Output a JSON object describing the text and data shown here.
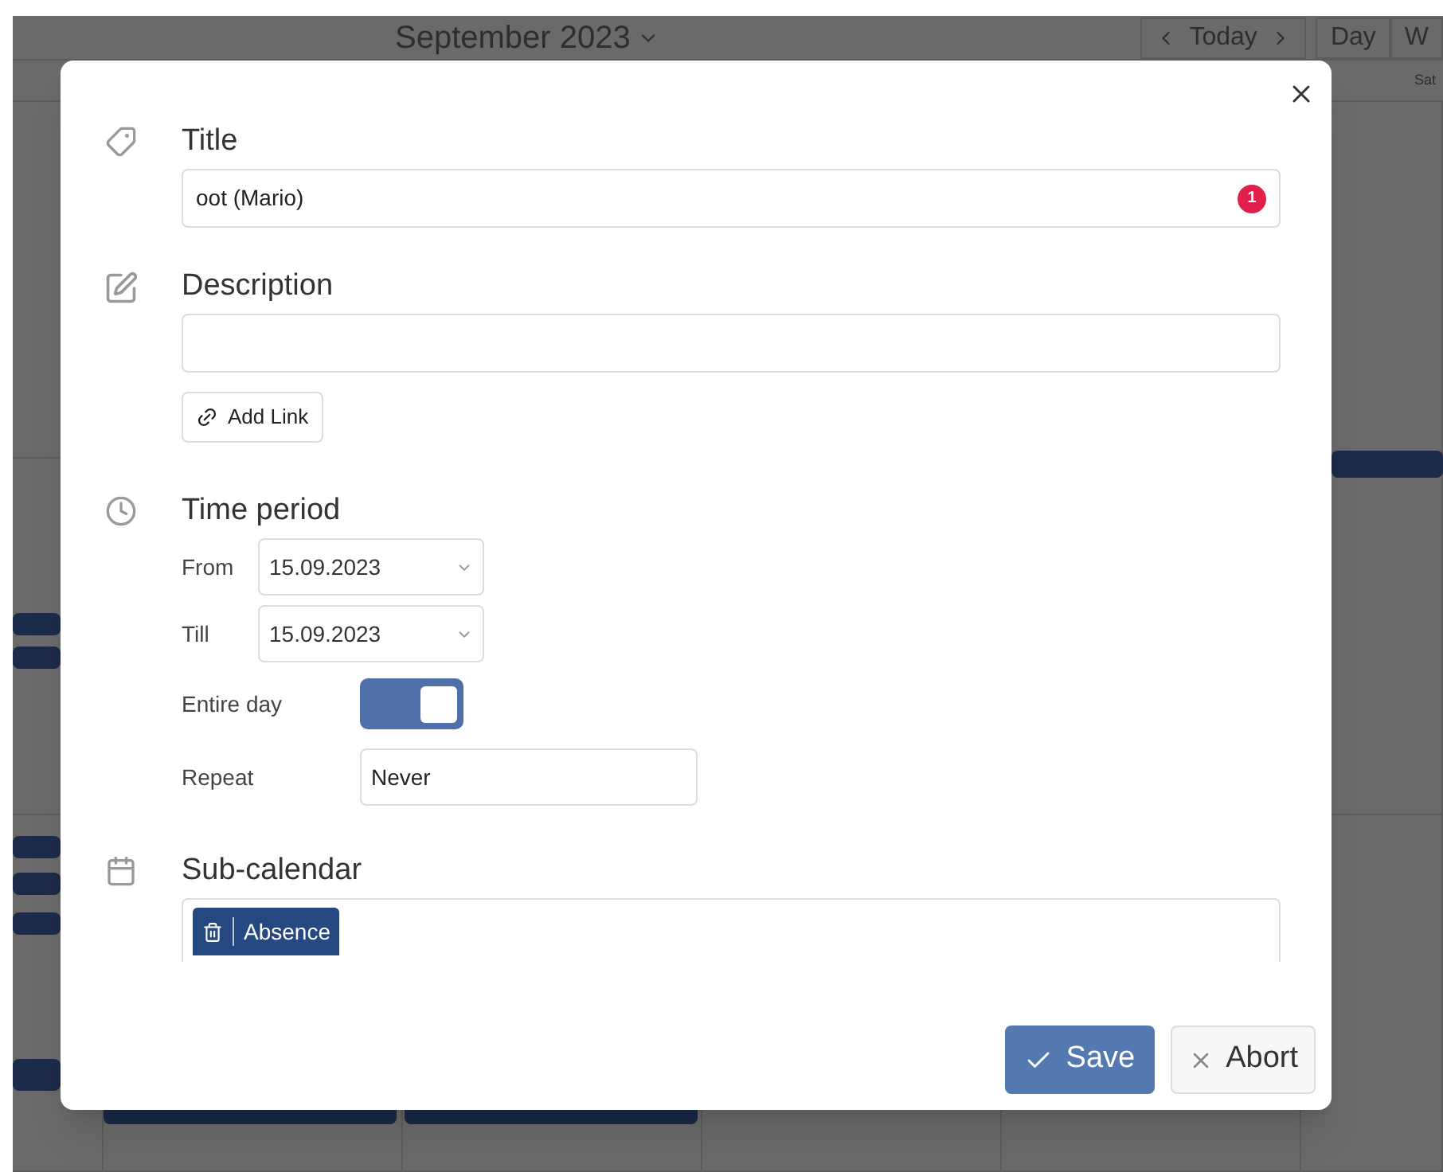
{
  "calendar": {
    "month": "September 2023",
    "today": "Today",
    "views": [
      "Day",
      "W"
    ],
    "weekday": "Sat"
  },
  "dialog": {
    "title_section": {
      "label": "Title",
      "value": "oot (Mario)",
      "badge": "1"
    },
    "description_section": {
      "label": "Description",
      "add_link": "Add Link"
    },
    "time_section": {
      "label": "Time period",
      "rows": [
        {
          "label": "From",
          "value": "15.09.2023"
        },
        {
          "label": "Till",
          "value": "15.09.2023"
        }
      ],
      "entire_day": {
        "label": "Entire day",
        "on": true
      },
      "repeat": {
        "label": "Repeat",
        "value": "Never"
      }
    },
    "subcalendar_section": {
      "label": "Sub-calendar",
      "chips": [
        {
          "label": "Absence"
        }
      ]
    },
    "buttons": [
      {
        "kind": "primary",
        "label": "Save"
      },
      {
        "kind": "secondary",
        "label": "Abort"
      }
    ]
  }
}
